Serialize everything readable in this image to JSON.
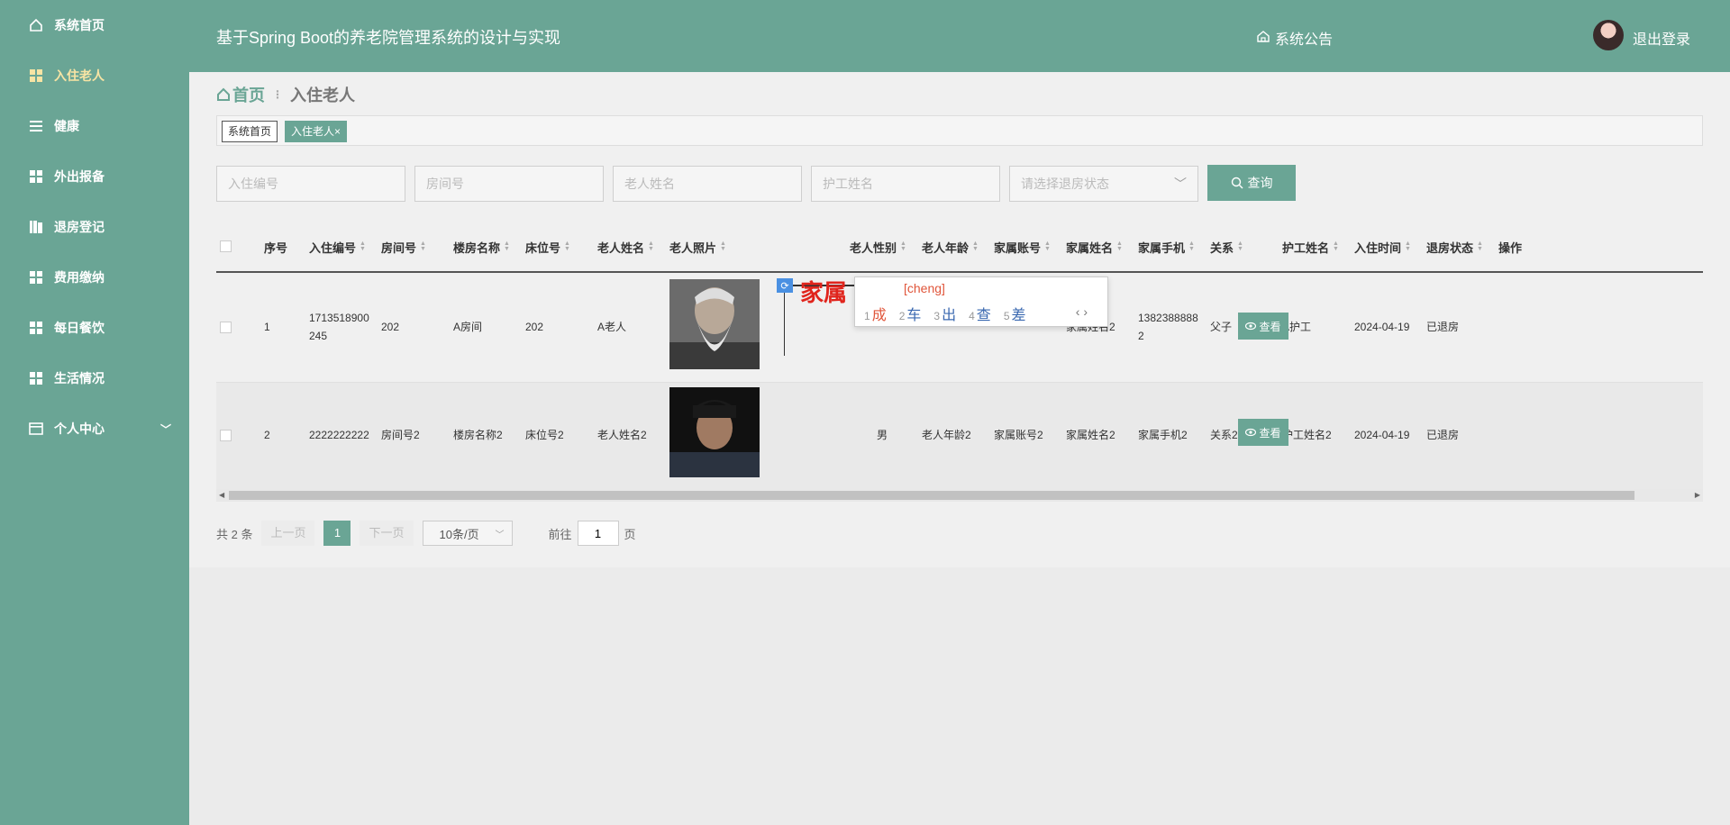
{
  "sidebar": {
    "items": [
      {
        "label": "系统首页",
        "icon": "home-icon"
      },
      {
        "label": "入住老人",
        "icon": "grid-icon"
      },
      {
        "label": "健康",
        "icon": "list-icon"
      },
      {
        "label": "外出报备",
        "icon": "grid-icon"
      },
      {
        "label": "退房登记",
        "icon": "book-icon"
      },
      {
        "label": "费用缴纳",
        "icon": "grid-icon"
      },
      {
        "label": "每日餐饮",
        "icon": "grid-icon"
      },
      {
        "label": "生活情况",
        "icon": "grid-icon"
      },
      {
        "label": "个人中心",
        "icon": "card-icon"
      }
    ],
    "active_index": 1
  },
  "header": {
    "title": "基于Spring Boot的养老院管理系统的设计与实现",
    "notice": "系统公告",
    "logout": "退出登录"
  },
  "breadcrumb": {
    "home": "首页",
    "sep": "⋮",
    "current": "入住老人"
  },
  "tags": [
    {
      "label": "系统首页"
    },
    {
      "label": "入住老人",
      "close": "×"
    }
  ],
  "search": {
    "checkin_no": "入住编号",
    "room_no": "房间号",
    "elder_name": "老人姓名",
    "nurse_name": "护工姓名",
    "status_placeholder": "请选择退房状态",
    "query_label": "查询"
  },
  "table": {
    "headers": [
      "序号",
      "入住编号",
      "房间号",
      "楼房名称",
      "床位号",
      "老人姓名",
      "老人照片",
      "老人性别",
      "老人年龄",
      "家属账号",
      "家属姓名",
      "家属手机",
      "关系",
      "护工姓名",
      "入住时间",
      "退房状态",
      "操作"
    ],
    "rows": [
      {
        "idx": "1",
        "checkin_no_a": "1713518900",
        "checkin_no_b": "245",
        "room": "202",
        "building": "A房间",
        "bed": "202",
        "name": "A老人",
        "gender": "",
        "age": "",
        "family_account": "",
        "family_name": "家属姓名2",
        "phone_a": "1382388888",
        "phone_b": "2",
        "relation": "父子",
        "nurse": "A护工",
        "date": "2024-04-19",
        "status": "已退房",
        "action": "查看"
      },
      {
        "idx": "2",
        "checkin_no_a": "2222222222",
        "checkin_no_b": "",
        "room": "房间号2",
        "building": "楼房名称2",
        "bed": "床位号2",
        "name": "老人姓名2",
        "gender": "男",
        "age": "老人年龄2",
        "family_account": "家属账号2",
        "family_name": "家属姓名2",
        "phone_a": "家属手机2",
        "phone_b": "",
        "relation": "关系2",
        "nurse": "护工姓名2",
        "date": "2024-04-19",
        "status": "已退房",
        "action": "查看"
      }
    ]
  },
  "ime": {
    "composition": "家属",
    "pinyin": "[cheng]",
    "candidates": [
      {
        "n": "1",
        "c": "成"
      },
      {
        "n": "2",
        "c": "车"
      },
      {
        "n": "3",
        "c": "出"
      },
      {
        "n": "4",
        "c": "查"
      },
      {
        "n": "5",
        "c": "差"
      }
    ],
    "nav": "‹ ›"
  },
  "pager": {
    "total": "共 2 条",
    "prev": "上一页",
    "current": "1",
    "next": "下一页",
    "page_size": "10条/页",
    "goto_label": "前往",
    "goto_value": "1",
    "page_unit": "页"
  },
  "colors": {
    "primary": "#6aa595",
    "active_menu": "#f7e4a4",
    "ime_red": "#e0241c"
  }
}
